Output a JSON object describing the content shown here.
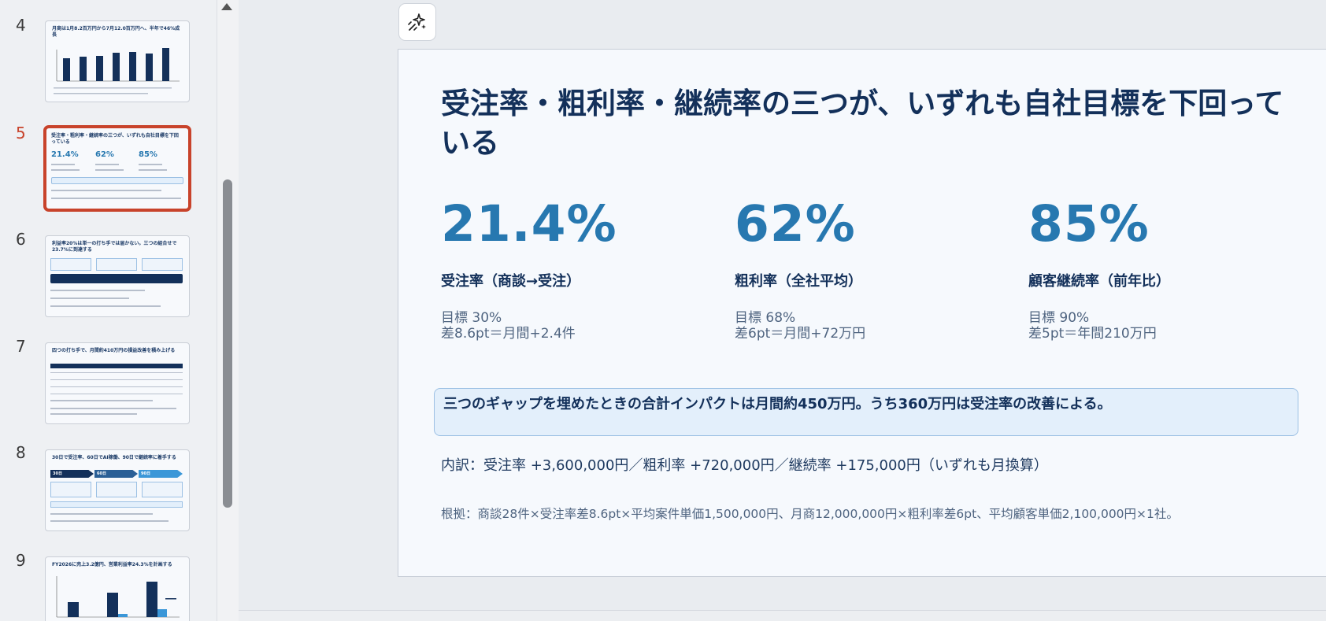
{
  "thumbnails": [
    {
      "number": "4",
      "title": "月商は1月8.2百万円から7月12.0百万円へ、半年で46%成長"
    },
    {
      "number": "5",
      "title": "受注率・粗利率・継続率の三つが、いずれも自社目標を下回っている",
      "kpis": [
        "21.4%",
        "62%",
        "85%"
      ]
    },
    {
      "number": "6",
      "title": "利益率20%は単一の打ち手では届かない。三つの組合せで23.7%に到達する"
    },
    {
      "number": "7",
      "title": "四つの打ち手で、月間約410万円の損益改善を積み上げる"
    },
    {
      "number": "8",
      "title": "30日で受注率、60日でAI稼働、90日で継続率に着手する",
      "stages": [
        "30日",
        "60日",
        "90日"
      ]
    },
    {
      "number": "9",
      "title": "FY2026に売上3.2億円、営業利益率24.3%を計画する"
    }
  ],
  "slide": {
    "title": "受注率・粗利率・継続率の三つが、いずれも自社目標を下回っている",
    "kpis": [
      {
        "value": "21.4%",
        "label": "受注率（商談→受注）",
        "target": "目標 30%",
        "gap": "差8.6pt＝月間+2.4件"
      },
      {
        "value": "62%",
        "label": "粗利率（全社平均）",
        "target": "目標 68%",
        "gap": "差6pt＝月間+72万円"
      },
      {
        "value": "85%",
        "label": "顧客継続率（前年比）",
        "target": "目標 90%",
        "gap": "差5pt＝年間210万円"
      }
    ],
    "callout": "三つのギャップを埋めたときの合計インパクトは月間約450万円。うち360万円は受注率の改善による。",
    "breakdown": "内訳：受注率 +3,600,000円／粗利率 +720,000円／継続率 +175,000円（いずれも月換算）",
    "basis": "根拠：商談28件×受注率差8.6pt×平均案件単価1,500,000円、月商12,000,000円×粗利率差6pt、平均顧客単価2,100,000円×1社。"
  },
  "icons": {
    "ai_button": "sparkle-icon"
  },
  "colors": {
    "accent": "#2778b0",
    "navy": "#13305a",
    "active_border": "#c8432b"
  }
}
